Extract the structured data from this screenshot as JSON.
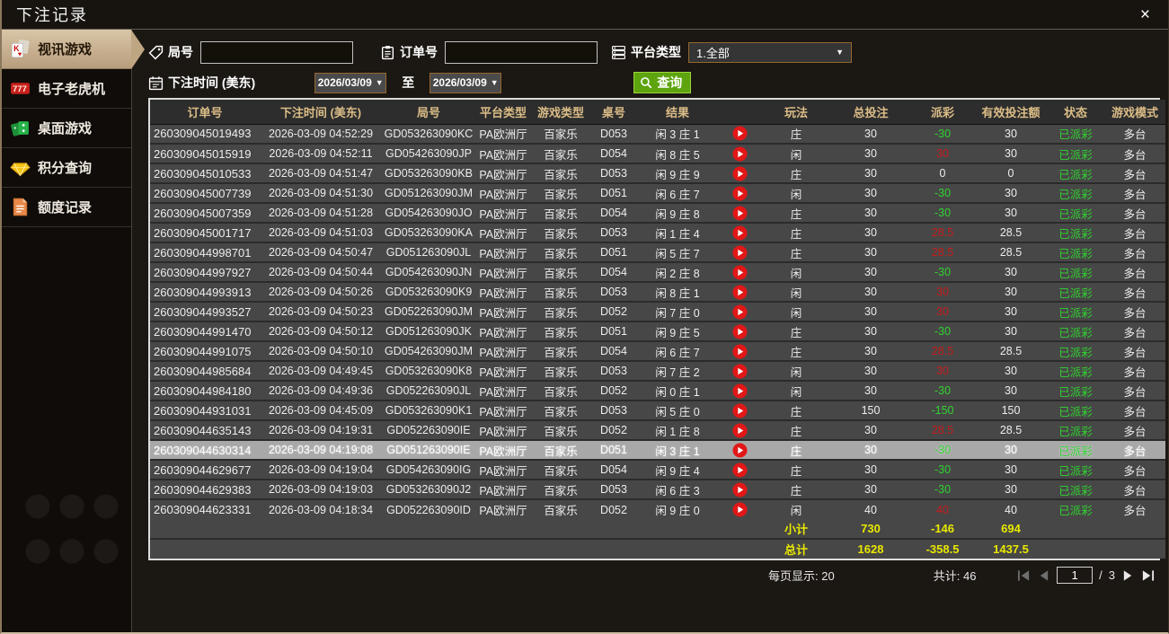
{
  "window": {
    "title": "下注记录",
    "close_glyph": "×"
  },
  "sidebar": {
    "items": [
      {
        "label": "视讯游戏",
        "icon": "playing-cards",
        "selected": true
      },
      {
        "label": "电子老虎机",
        "icon": "slot-777",
        "selected": false
      },
      {
        "label": "桌面游戏",
        "icon": "dominoes",
        "selected": false
      },
      {
        "label": "积分查询",
        "icon": "gem",
        "selected": false
      },
      {
        "label": "额度记录",
        "icon": "document",
        "selected": false
      }
    ]
  },
  "filters": {
    "round_label": "局号",
    "round_value": "",
    "order_label": "订单号",
    "order_value": "",
    "platform_label": "平台类型",
    "platform_value": "1.全部",
    "caret": "▼",
    "time_label": "下注时间 (美东)",
    "date_from": "2026/03/09",
    "to_label": "至",
    "date_to": "2026/03/09",
    "search_label": "查询"
  },
  "table": {
    "headers": [
      "订单号",
      "下注时间 (美东)",
      "局号",
      "平台类型",
      "游戏类型",
      "桌号",
      "结果",
      "",
      "玩法",
      "总投注",
      "派彩",
      "有效投注额",
      "状态",
      "游戏模式"
    ],
    "rows": [
      {
        "order_no": "260309045019493",
        "bet_time": "2026-03-09 04:52:29",
        "round_no": "GD053263090KC",
        "platform": "PA欧洲厅",
        "game_type": "百家乐",
        "table_no": "D053",
        "result": "闲 3 庄 1",
        "side": "庄",
        "total_bet": "30",
        "payout": "-30",
        "payout_color": "green",
        "valid_bet": "30",
        "status": "已派彩",
        "mode": "多台",
        "highlighted": false
      },
      {
        "order_no": "260309045015919",
        "bet_time": "2026-03-09 04:52:11",
        "round_no": "GD054263090JP",
        "platform": "PA欧洲厅",
        "game_type": "百家乐",
        "table_no": "D054",
        "result": "闲 8 庄 5",
        "side": "闲",
        "total_bet": "30",
        "payout": "30",
        "payout_color": "red",
        "valid_bet": "30",
        "status": "已派彩",
        "mode": "多台",
        "highlighted": false
      },
      {
        "order_no": "260309045010533",
        "bet_time": "2026-03-09 04:51:47",
        "round_no": "GD053263090KB",
        "platform": "PA欧洲厅",
        "game_type": "百家乐",
        "table_no": "D053",
        "result": "闲 9 庄 9",
        "side": "庄",
        "total_bet": "30",
        "payout": "0",
        "payout_color": "white",
        "valid_bet": "0",
        "status": "已派彩",
        "mode": "多台",
        "highlighted": false
      },
      {
        "order_no": "260309045007739",
        "bet_time": "2026-03-09 04:51:30",
        "round_no": "GD051263090JM",
        "platform": "PA欧洲厅",
        "game_type": "百家乐",
        "table_no": "D051",
        "result": "闲 6 庄 7",
        "side": "闲",
        "total_bet": "30",
        "payout": "-30",
        "payout_color": "green",
        "valid_bet": "30",
        "status": "已派彩",
        "mode": "多台",
        "highlighted": false
      },
      {
        "order_no": "260309045007359",
        "bet_time": "2026-03-09 04:51:28",
        "round_no": "GD054263090JO",
        "platform": "PA欧洲厅",
        "game_type": "百家乐",
        "table_no": "D054",
        "result": "闲 9 庄 8",
        "side": "庄",
        "total_bet": "30",
        "payout": "-30",
        "payout_color": "green",
        "valid_bet": "30",
        "status": "已派彩",
        "mode": "多台",
        "highlighted": false
      },
      {
        "order_no": "260309045001717",
        "bet_time": "2026-03-09 04:51:03",
        "round_no": "GD053263090KA",
        "platform": "PA欧洲厅",
        "game_type": "百家乐",
        "table_no": "D053",
        "result": "闲 1 庄 4",
        "side": "庄",
        "total_bet": "30",
        "payout": "28.5",
        "payout_color": "red",
        "valid_bet": "28.5",
        "status": "已派彩",
        "mode": "多台",
        "highlighted": false
      },
      {
        "order_no": "260309044998701",
        "bet_time": "2026-03-09 04:50:47",
        "round_no": "GD051263090JL",
        "platform": "PA欧洲厅",
        "game_type": "百家乐",
        "table_no": "D051",
        "result": "闲 5 庄 7",
        "side": "庄",
        "total_bet": "30",
        "payout": "28.5",
        "payout_color": "red",
        "valid_bet": "28.5",
        "status": "已派彩",
        "mode": "多台",
        "highlighted": false
      },
      {
        "order_no": "260309044997927",
        "bet_time": "2026-03-09 04:50:44",
        "round_no": "GD054263090JN",
        "platform": "PA欧洲厅",
        "game_type": "百家乐",
        "table_no": "D054",
        "result": "闲 2 庄 8",
        "side": "闲",
        "total_bet": "30",
        "payout": "-30",
        "payout_color": "green",
        "valid_bet": "30",
        "status": "已派彩",
        "mode": "多台",
        "highlighted": false
      },
      {
        "order_no": "260309044993913",
        "bet_time": "2026-03-09 04:50:26",
        "round_no": "GD053263090K9",
        "platform": "PA欧洲厅",
        "game_type": "百家乐",
        "table_no": "D053",
        "result": "闲 8 庄 1",
        "side": "闲",
        "total_bet": "30",
        "payout": "30",
        "payout_color": "red",
        "valid_bet": "30",
        "status": "已派彩",
        "mode": "多台",
        "highlighted": false
      },
      {
        "order_no": "260309044993527",
        "bet_time": "2026-03-09 04:50:23",
        "round_no": "GD052263090JM",
        "platform": "PA欧洲厅",
        "game_type": "百家乐",
        "table_no": "D052",
        "result": "闲 7 庄 0",
        "side": "闲",
        "total_bet": "30",
        "payout": "30",
        "payout_color": "red",
        "valid_bet": "30",
        "status": "已派彩",
        "mode": "多台",
        "highlighted": false
      },
      {
        "order_no": "260309044991470",
        "bet_time": "2026-03-09 04:50:12",
        "round_no": "GD051263090JK",
        "platform": "PA欧洲厅",
        "game_type": "百家乐",
        "table_no": "D051",
        "result": "闲 9 庄 5",
        "side": "庄",
        "total_bet": "30",
        "payout": "-30",
        "payout_color": "green",
        "valid_bet": "30",
        "status": "已派彩",
        "mode": "多台",
        "highlighted": false
      },
      {
        "order_no": "260309044991075",
        "bet_time": "2026-03-09 04:50:10",
        "round_no": "GD054263090JM",
        "platform": "PA欧洲厅",
        "game_type": "百家乐",
        "table_no": "D054",
        "result": "闲 6 庄 7",
        "side": "庄",
        "total_bet": "30",
        "payout": "28.5",
        "payout_color": "red",
        "valid_bet": "28.5",
        "status": "已派彩",
        "mode": "多台",
        "highlighted": false
      },
      {
        "order_no": "260309044985684",
        "bet_time": "2026-03-09 04:49:45",
        "round_no": "GD053263090K8",
        "platform": "PA欧洲厅",
        "game_type": "百家乐",
        "table_no": "D053",
        "result": "闲 7 庄 2",
        "side": "闲",
        "total_bet": "30",
        "payout": "30",
        "payout_color": "red",
        "valid_bet": "30",
        "status": "已派彩",
        "mode": "多台",
        "highlighted": false
      },
      {
        "order_no": "260309044984180",
        "bet_time": "2026-03-09 04:49:36",
        "round_no": "GD052263090JL",
        "platform": "PA欧洲厅",
        "game_type": "百家乐",
        "table_no": "D052",
        "result": "闲 0 庄 1",
        "side": "闲",
        "total_bet": "30",
        "payout": "-30",
        "payout_color": "green",
        "valid_bet": "30",
        "status": "已派彩",
        "mode": "多台",
        "highlighted": false
      },
      {
        "order_no": "260309044931031",
        "bet_time": "2026-03-09 04:45:09",
        "round_no": "GD053263090K1",
        "platform": "PA欧洲厅",
        "game_type": "百家乐",
        "table_no": "D053",
        "result": "闲 5 庄 0",
        "side": "庄",
        "total_bet": "150",
        "payout": "-150",
        "payout_color": "green",
        "valid_bet": "150",
        "status": "已派彩",
        "mode": "多台",
        "highlighted": false
      },
      {
        "order_no": "260309044635143",
        "bet_time": "2026-03-09 04:19:31",
        "round_no": "GD052263090IE",
        "platform": "PA欧洲厅",
        "game_type": "百家乐",
        "table_no": "D052",
        "result": "闲 1 庄 8",
        "side": "庄",
        "total_bet": "30",
        "payout": "28.5",
        "payout_color": "red",
        "valid_bet": "28.5",
        "status": "已派彩",
        "mode": "多台",
        "highlighted": false
      },
      {
        "order_no": "260309044630314",
        "bet_time": "2026-03-09 04:19:08",
        "round_no": "GD051263090IE",
        "platform": "PA欧洲厅",
        "game_type": "百家乐",
        "table_no": "D051",
        "result": "闲 3 庄 1",
        "side": "庄",
        "total_bet": "30",
        "payout": "-30",
        "payout_color": "green",
        "valid_bet": "30",
        "status": "已派彩",
        "mode": "多台",
        "highlighted": true
      },
      {
        "order_no": "260309044629677",
        "bet_time": "2026-03-09 04:19:04",
        "round_no": "GD054263090IG",
        "platform": "PA欧洲厅",
        "game_type": "百家乐",
        "table_no": "D054",
        "result": "闲 9 庄 4",
        "side": "庄",
        "total_bet": "30",
        "payout": "-30",
        "payout_color": "green",
        "valid_bet": "30",
        "status": "已派彩",
        "mode": "多台",
        "highlighted": false
      },
      {
        "order_no": "260309044629383",
        "bet_time": "2026-03-09 04:19:03",
        "round_no": "GD053263090J2",
        "platform": "PA欧洲厅",
        "game_type": "百家乐",
        "table_no": "D053",
        "result": "闲 6 庄 3",
        "side": "庄",
        "total_bet": "30",
        "payout": "-30",
        "payout_color": "green",
        "valid_bet": "30",
        "status": "已派彩",
        "mode": "多台",
        "highlighted": false
      },
      {
        "order_no": "260309044623331",
        "bet_time": "2026-03-09 04:18:34",
        "round_no": "GD052263090ID",
        "platform": "PA欧洲厅",
        "game_type": "百家乐",
        "table_no": "D052",
        "result": "闲 9 庄 0",
        "side": "闲",
        "total_bet": "40",
        "payout": "40",
        "payout_color": "red",
        "valid_bet": "40",
        "status": "已派彩",
        "mode": "多台",
        "highlighted": false
      }
    ],
    "subtotal": {
      "label": "小计",
      "total_bet": "730",
      "payout": "-146",
      "valid_bet": "694"
    },
    "total": {
      "label": "总计",
      "total_bet": "1628",
      "payout": "-358.5",
      "valid_bet": "1437.5"
    }
  },
  "footer": {
    "page_size_label": "每页显示:",
    "page_size": "20",
    "total_count_label": "共计:",
    "total_count": "46",
    "page": "1",
    "page_separator": "/",
    "page_count": "3"
  },
  "colors": {
    "win_red": "#c61d1d",
    "loss_green": "#2fd32f",
    "totals_yellow": "#e8e800",
    "header_gold": "#dcbd87",
    "selected_tab_tan": "#c9b098",
    "search_green": "#5da40e"
  }
}
